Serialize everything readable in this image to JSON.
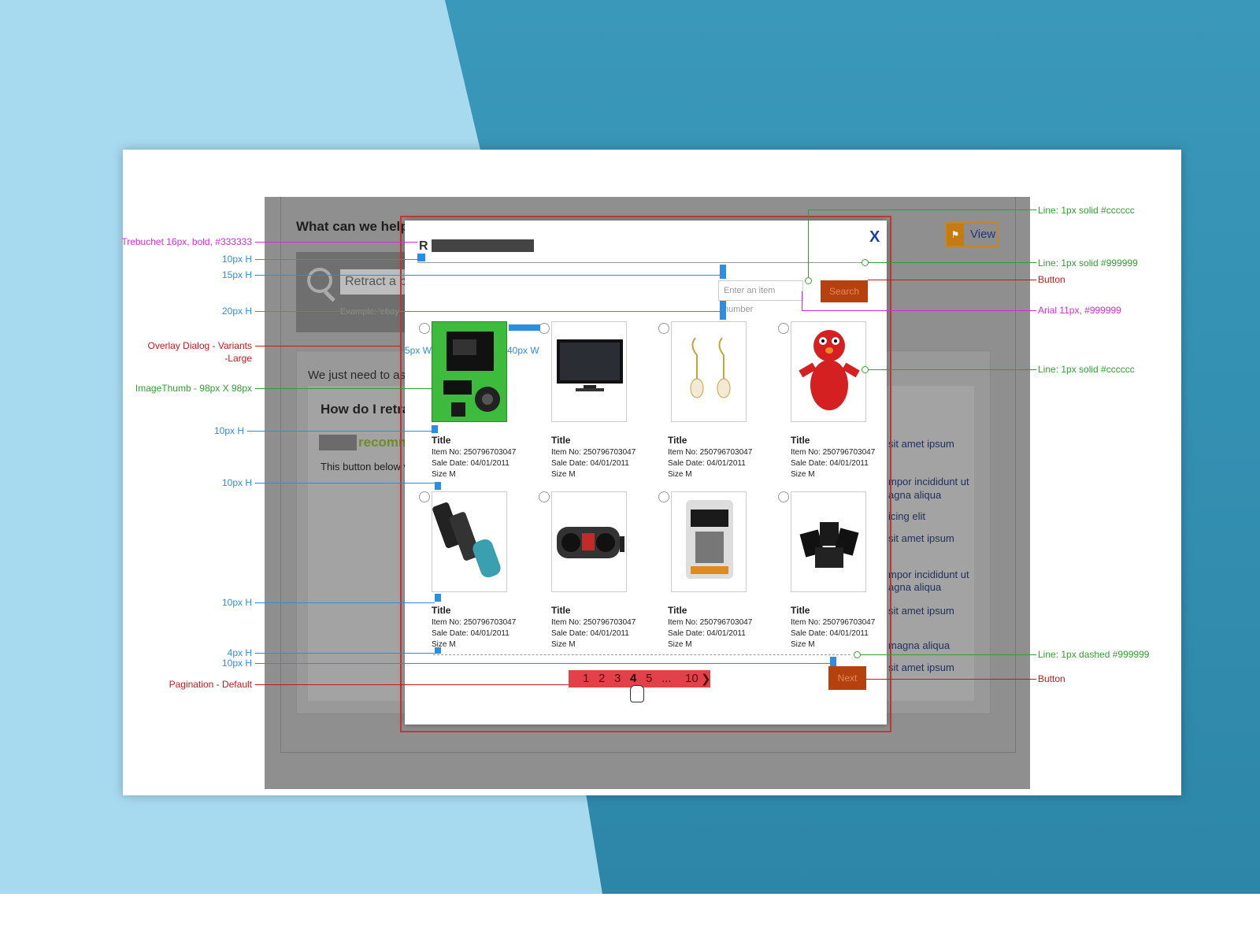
{
  "page": {
    "title": "What can we help",
    "search_placeholder": "Retract a b",
    "search_hint": "Example: 'ebay",
    "intro": "We just need to ask",
    "howdo": "How do I retra",
    "recommend": "recomme",
    "button_note": "This button below v",
    "view_button": "View",
    "lorem": [
      "sit amet ipsum",
      "mpor incididunt ut",
      "agna aliqua",
      "icing elit",
      "sit amet ipsum",
      "mpor incididunt ut",
      "agna aliqua",
      "sit amet ipsum",
      "magna aliqua",
      "sit amet ipsum"
    ]
  },
  "dialog": {
    "title": "R",
    "close": "X",
    "search_placeholder": "Enter an item number",
    "search_button": "Search",
    "next_button": "Next",
    "items": [
      {
        "title": "Title",
        "item_no": "Item No: 250796703047",
        "sale_date": "Sale Date: 04/01/2011",
        "size": "Size M",
        "image": "camera-kit"
      },
      {
        "title": "Title",
        "item_no": "Item No: 250796703047",
        "sale_date": "Sale Date: 04/01/2011",
        "size": "Size M",
        "image": "tv"
      },
      {
        "title": "Title",
        "item_no": "Item No: 250796703047",
        "sale_date": "Sale Date: 04/01/2011",
        "size": "Size M",
        "image": "earrings"
      },
      {
        "title": "Title",
        "item_no": "Item No: 250796703047",
        "sale_date": "Sale Date: 04/01/2011",
        "size": "Size M",
        "image": "elmo"
      },
      {
        "title": "Title",
        "item_no": "Item No: 250796703047",
        "sale_date": "Sale Date: 04/01/2011",
        "size": "Size M",
        "image": "phones"
      },
      {
        "title": "Title",
        "item_no": "Item No: 250796703047",
        "sale_date": "Sale Date: 04/01/2011",
        "size": "Size M",
        "image": "boombox"
      },
      {
        "title": "Title",
        "item_no": "Item No: 250796703047",
        "sale_date": "Sale Date: 04/01/2011",
        "size": "Size M",
        "image": "charger"
      },
      {
        "title": "Title",
        "item_no": "Item No: 250796703047",
        "sale_date": "Sale Date: 04/01/2011",
        "size": "Size M",
        "image": "memory-cards"
      }
    ],
    "pagination": [
      "1",
      "2",
      "3",
      "4",
      "5",
      "...",
      "10",
      "❯"
    ]
  },
  "annotations": {
    "left": {
      "font": "Trebuchet 16px, bold, #333333",
      "h10a": "10px H",
      "h15": "15px H",
      "h20": "20px H",
      "overlay": "Overlay Dialog - Variants",
      "overlay2": "-Large",
      "thumb": "ImageThumb - 98px X 98px",
      "h10b": "10px H",
      "h10c": "10px H",
      "h10d": "10px H",
      "h4": "4px H",
      "h10e": "10px H",
      "pagination": "Pagination - Default"
    },
    "inner": {
      "w5": "5px W",
      "w40": "40px W"
    },
    "right": {
      "line_cccccc_a": "Line: 1px solid #cccccc",
      "line_999999": "Line: 1px solid #999999",
      "button_a": "Button",
      "arial": "Arial 11px, #999999",
      "line_cccccc_b": "Line: 1px solid #cccccc",
      "line_dashed": "Line: 1px dashed #999999",
      "button_b": "Button"
    }
  },
  "colors": {
    "annotation_pink": "#d92ad9",
    "annotation_blue": "#2f8de0",
    "annotation_red": "#c41a1a",
    "annotation_green": "#30a030",
    "button": "#b5410f",
    "pagination": "#e3414a"
  }
}
